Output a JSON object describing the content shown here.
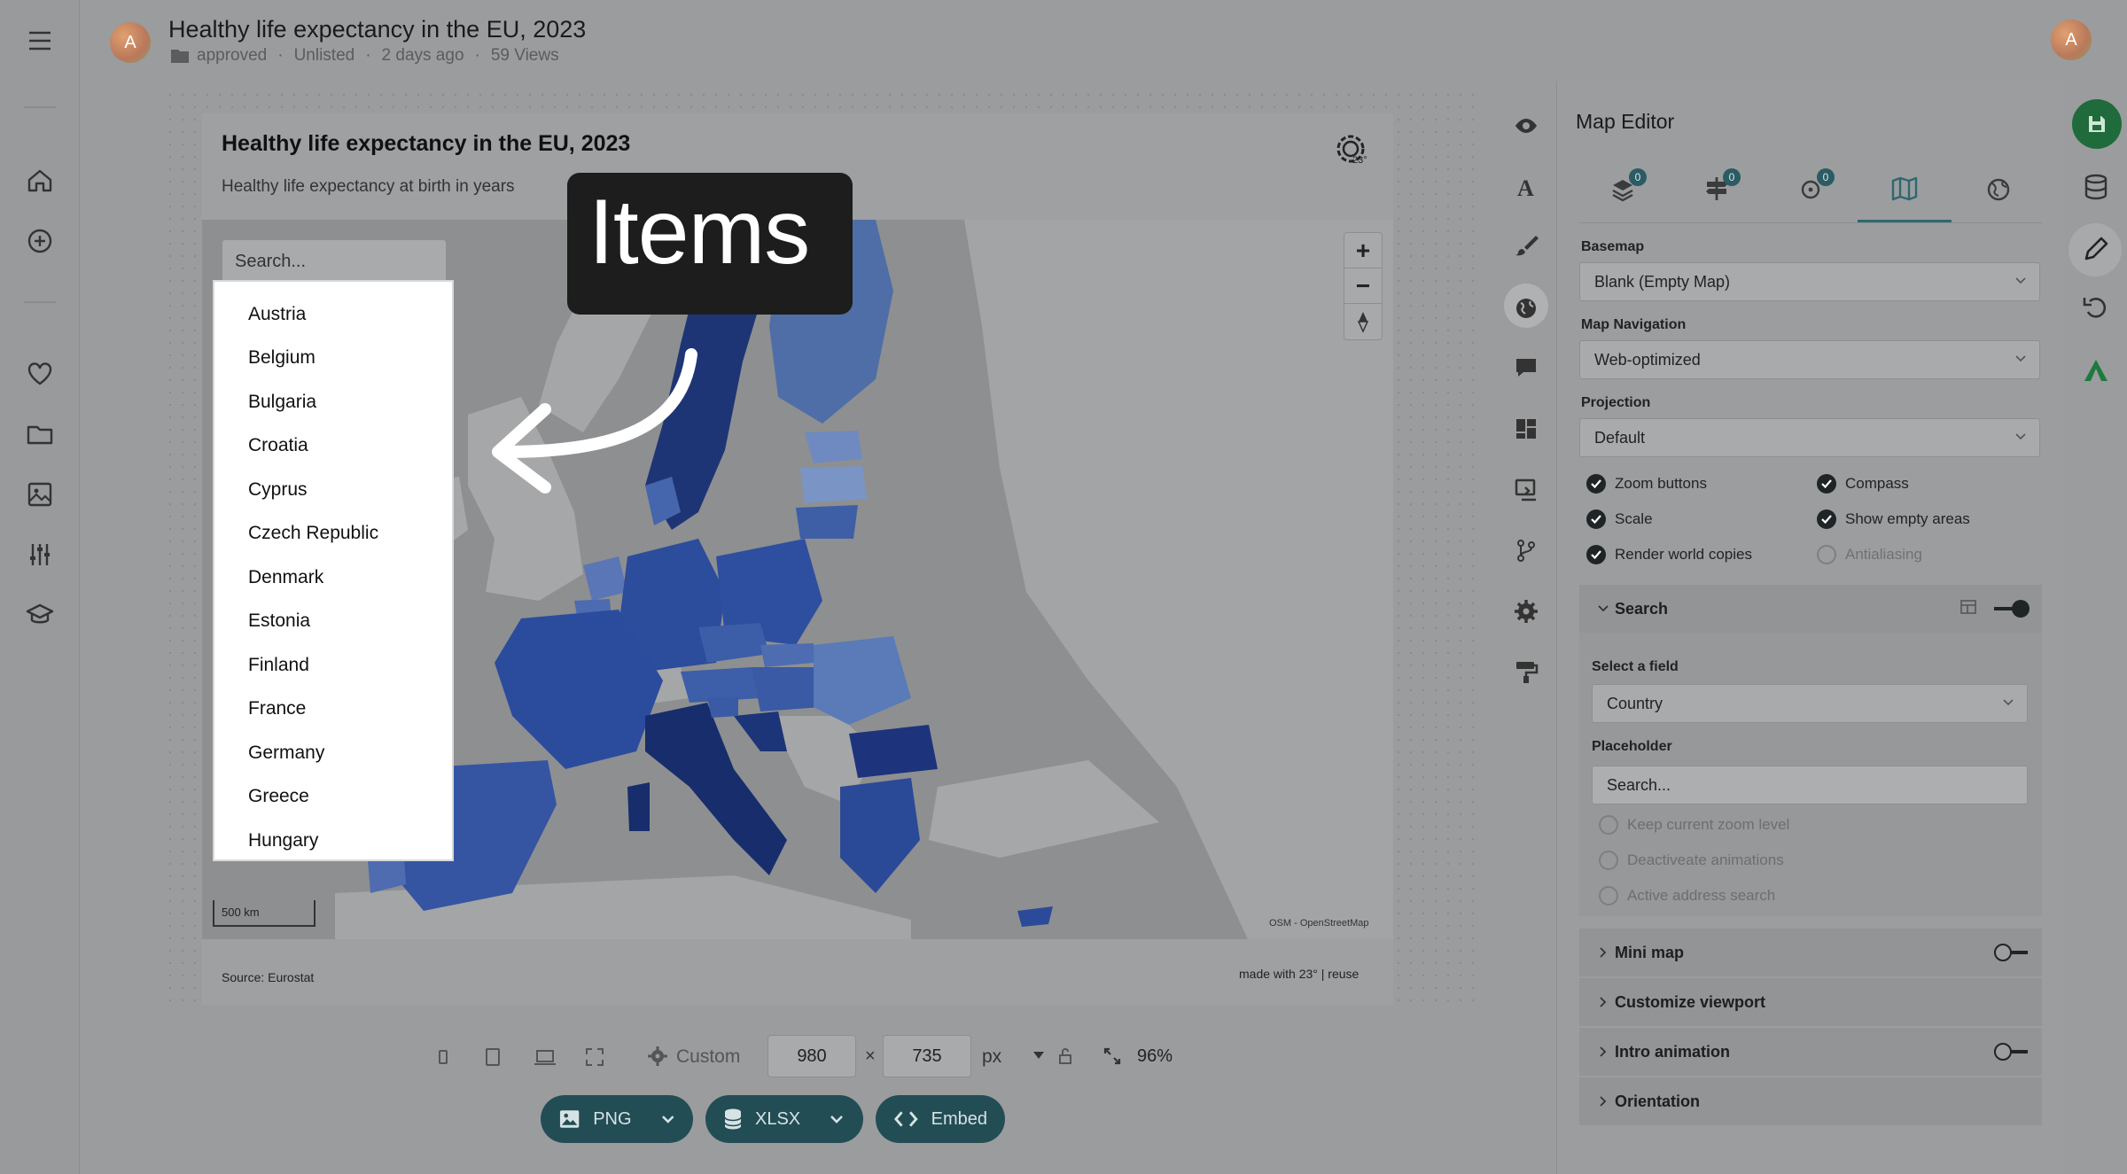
{
  "header": {
    "avatar_letter": "A",
    "title": "Healthy life expectancy in the EU, 2023",
    "folder": "approved",
    "visibility": "Unlisted",
    "time": "2 days ago",
    "views": "59 Views"
  },
  "chart": {
    "title": "Healthy life expectancy in the EU, 2023",
    "subtitle": "Healthy life expectancy at birth in years",
    "source": "Source: Eurostat",
    "made_with": "made with 23° | reuse",
    "attribution": "OSM - OpenStreetMap",
    "scale": "500 km",
    "zoom_in": "+",
    "zoom_out": "−"
  },
  "search": {
    "placeholder": "Search...",
    "items": [
      "Austria",
      "Belgium",
      "Bulgaria",
      "Croatia",
      "Cyprus",
      "Czech Republic",
      "Denmark",
      "Estonia",
      "Finland",
      "France",
      "Germany",
      "Greece",
      "Hungary"
    ]
  },
  "tooltip": {
    "text": "Items"
  },
  "bottom_bar": {
    "size_preset": "Custom",
    "width": "980",
    "times": "×",
    "height": "735",
    "unit": "px",
    "zoom": "96%",
    "png": "PNG",
    "xlsx": "XLSX",
    "embed": "Embed"
  },
  "panel": {
    "title": "Map Editor",
    "tab_badges": [
      "0",
      "0",
      "0"
    ],
    "basemap_label": "Basemap",
    "basemap_value": "Blank (Empty Map)",
    "navigation_label": "Map Navigation",
    "navigation_value": "Web-optimized",
    "projection_label": "Projection",
    "projection_value": "Default",
    "options": {
      "zoom_buttons": "Zoom buttons",
      "compass": "Compass",
      "scale": "Scale",
      "show_empty": "Show empty areas",
      "world_copies": "Render world copies",
      "antialiasing": "Antialiasing"
    },
    "search_section": "Search",
    "select_field_label": "Select a field",
    "select_field_value": "Country",
    "placeholder_label": "Placeholder",
    "placeholder_value": "Search...",
    "radios": {
      "keep_zoom": "Keep current zoom level",
      "deactivate_anim": "Deactiveate animations",
      "address_search": "Active address search"
    },
    "mini_map": "Mini map",
    "customize_viewport": "Customize viewport",
    "intro_animation": "Intro animation",
    "orientation": "Orientation"
  },
  "colors": {
    "accent": "#234d54",
    "map_dark": "#1e3a7a",
    "map_mid": "#3c62a8",
    "map_light": "#7d95c4"
  }
}
